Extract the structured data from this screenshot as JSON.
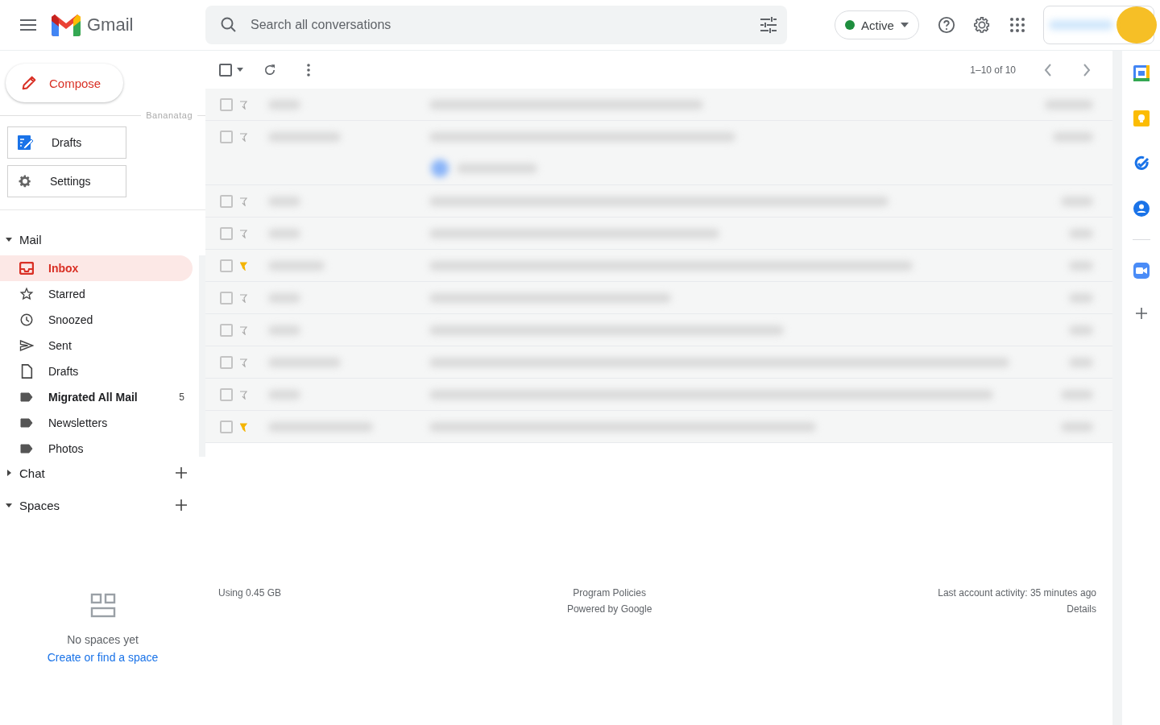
{
  "app": {
    "name": "Gmail"
  },
  "search": {
    "placeholder": "Search all conversations"
  },
  "status": {
    "label": "Active",
    "color": "#1e8e3e"
  },
  "compose": {
    "label": "Compose"
  },
  "addon": {
    "title": "Bananatag",
    "buttons": [
      {
        "kind": "drafts",
        "label": "Drafts"
      },
      {
        "kind": "settings",
        "label": "Settings"
      }
    ]
  },
  "mail_section": {
    "label": "Mail",
    "expanded": true
  },
  "nav": [
    {
      "kind": "inbox",
      "label": "Inbox",
      "selected": true,
      "unread": true
    },
    {
      "kind": "starred",
      "label": "Starred",
      "selected": false,
      "unread": false
    },
    {
      "kind": "snoozed",
      "label": "Snoozed",
      "selected": false,
      "unread": false
    },
    {
      "kind": "sent",
      "label": "Sent",
      "selected": false,
      "unread": false
    },
    {
      "kind": "drafts",
      "label": "Drafts",
      "selected": false,
      "unread": false
    },
    {
      "kind": "label",
      "label": "Migrated All Mail",
      "selected": false,
      "unread": true,
      "count": "5"
    },
    {
      "kind": "label",
      "label": "Newsletters",
      "selected": false,
      "unread": false
    },
    {
      "kind": "label",
      "label": "Photos",
      "selected": false,
      "unread": false
    }
  ],
  "chat_section": {
    "label": "Chat",
    "expanded": false
  },
  "spaces_section": {
    "label": "Spaces",
    "expanded": true
  },
  "spaces_empty": {
    "text": "No spaces yet",
    "link": "Create or find a space"
  },
  "select_all": {
    "checked": false
  },
  "pagination": "1–10 of 10",
  "rows": [
    {
      "checked": false,
      "starred": false,
      "chip": false
    },
    {
      "checked": false,
      "starred": false,
      "chip": true
    },
    {
      "checked": false,
      "starred": false,
      "chip": false
    },
    {
      "checked": false,
      "starred": false,
      "chip": false
    },
    {
      "checked": false,
      "starred": true,
      "chip": false
    },
    {
      "checked": false,
      "starred": false,
      "chip": false
    },
    {
      "checked": false,
      "starred": false,
      "chip": false
    },
    {
      "checked": false,
      "starred": false,
      "chip": false
    },
    {
      "checked": false,
      "starred": false,
      "chip": false
    },
    {
      "checked": false,
      "starred": true,
      "chip": false
    }
  ],
  "footer": {
    "storage": "Using 0.45 GB",
    "center": [
      "Program Policies",
      "Powered by Google"
    ],
    "activity": "Last account activity: 35 minutes ago",
    "details": "Details"
  }
}
